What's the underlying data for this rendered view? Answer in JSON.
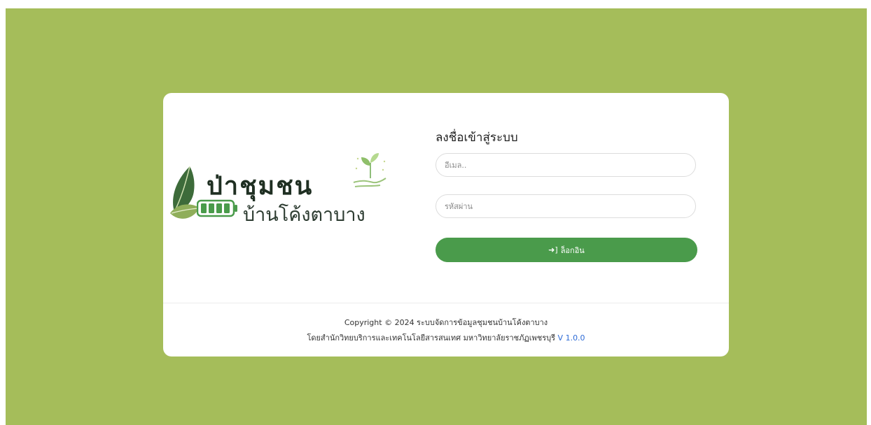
{
  "logo": {
    "title": "ป่าชุมชน",
    "subtitle": "บ้านโค้งตาบาง",
    "icons": [
      "leaf-icon",
      "battery-icon",
      "sprout-hand-icon"
    ],
    "colors": {
      "leaf_dark": "#3d6b3a",
      "leaf_light": "#8fae5a",
      "battery": "#4a9b4b"
    }
  },
  "login": {
    "title": "ลงชื่อเข้าสู่ระบบ",
    "email_placeholder": "อีเมล..",
    "password_placeholder": "รหัสผ่าน",
    "button_label": "ล็อกอิน",
    "button_icon": "sign-in-icon"
  },
  "footer": {
    "copyright": "Copyright © 2024 ระบบจัดการข้อมูลชุมชนบ้านโค้งตาบาง",
    "credit": "โดยสำนักวิทยบริการและเทคโนโลยีสารสนเทศ มหาวิทยาลัยราชภัฏเพชรบุรี",
    "version": "V 1.0.0"
  },
  "colors": {
    "background": "#a5bd5a",
    "card": "#ffffff",
    "primary_button": "#4a9b4b",
    "version_link": "#2e6bd6"
  }
}
